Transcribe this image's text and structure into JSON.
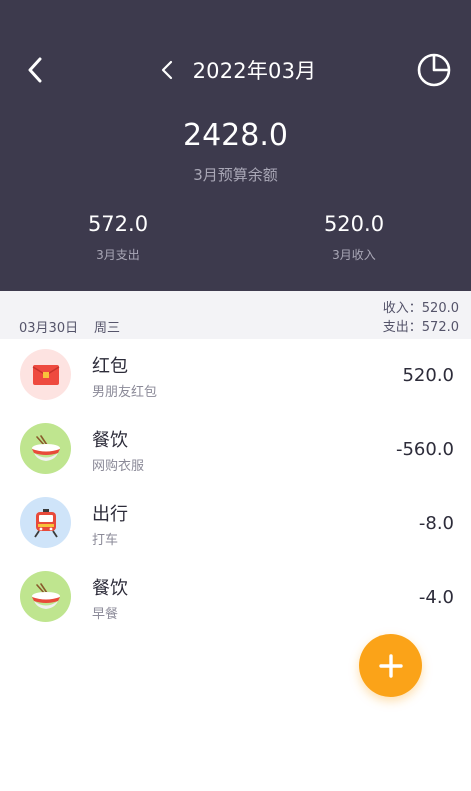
{
  "header": {
    "month_title": "2022年03月",
    "balance": "2428.0",
    "balance_label": "3月预算余额",
    "expense_value": "572.0",
    "expense_label": "3月支出",
    "income_value": "520.0",
    "income_label": "3月收入",
    "icons": {
      "back": "back-arrow-icon",
      "prev": "prev-month-icon",
      "chart": "pie-chart-icon"
    }
  },
  "day": {
    "date": "03月30日",
    "weekday": "周三",
    "income_summary": "收入：520.0",
    "expense_summary": "支出：572.0"
  },
  "records": [
    {
      "title": "红包",
      "note": "男朋友红包",
      "amount": "520.0",
      "icon": "red-envelope-icon",
      "icon_bg": "#fde3e1"
    },
    {
      "title": "餐饮",
      "note": "网购衣服",
      "amount": "-560.0",
      "icon": "rice-bowl-icon",
      "icon_bg": "#bfe58f"
    },
    {
      "title": "出行",
      "note": "打车",
      "amount": "-8.0",
      "icon": "train-icon",
      "icon_bg": "#cfe4f9"
    },
    {
      "title": "餐饮",
      "note": "早餐",
      "amount": "-4.0",
      "icon": "rice-bowl-icon",
      "icon_bg": "#bfe58f"
    }
  ],
  "fab": {
    "icon": "plus-icon",
    "color": "#fba318"
  },
  "colors": {
    "header_bg": "#3d3a4d",
    "day_bar_bg": "#f3f3f6"
  }
}
